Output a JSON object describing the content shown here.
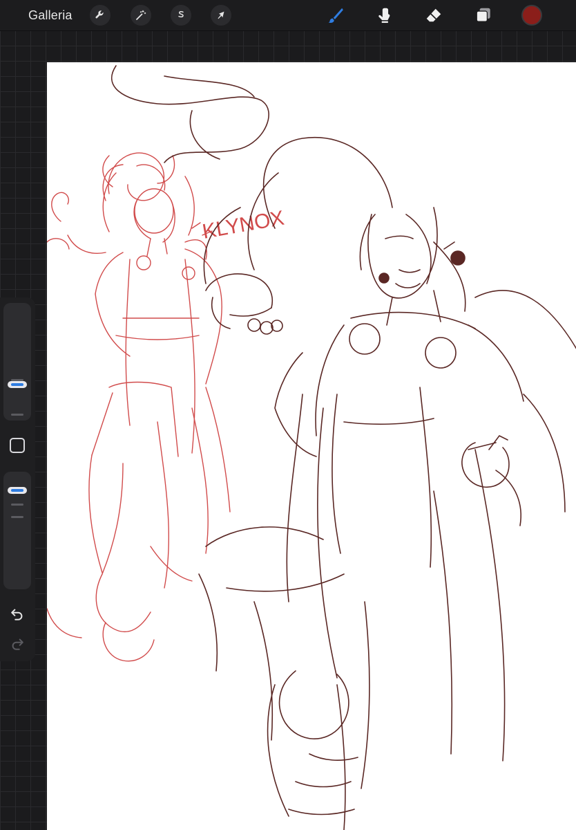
{
  "toolbar": {
    "gallery_label": "Galleria",
    "actions_icon": "wrench-icon",
    "adjustments_icon": "magic-wand-icon",
    "selection_icon": "selection-s-icon",
    "transform_icon": "arrow-cursor-icon",
    "brush_icon": "brush-icon",
    "smudge_icon": "smudge-finger-icon",
    "eraser_icon": "eraser-icon",
    "layers_icon": "layers-icon",
    "active_tool": "brush",
    "current_color": "#8b1e1a",
    "accent_color": "#2f7de1"
  },
  "sidebar": {
    "brush_size": 0.27,
    "brush_opacity": 0.9,
    "undo_icon": "undo-icon",
    "redo_icon": "redo-icon"
  },
  "canvas": {
    "background": "#ffffff",
    "sketch_colors": [
      "#d14b4b",
      "#5a2724"
    ],
    "sketch_text": "KLYNOX"
  }
}
